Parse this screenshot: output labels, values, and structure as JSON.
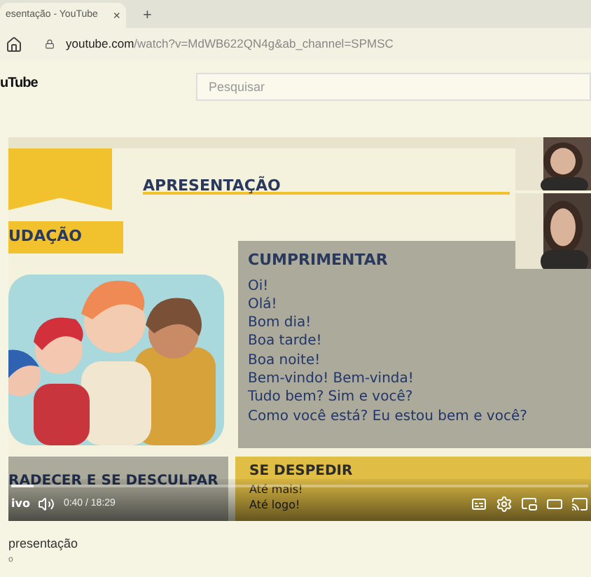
{
  "browser": {
    "tab": {
      "title": "esentação - YouTube",
      "close": "×"
    },
    "new_tab": "+",
    "url": {
      "host": "youtube.com",
      "path": "/watch?v=MdWB622QN4g&ab_channel=SPMSC"
    }
  },
  "youtube": {
    "logo": "uTube",
    "search": {
      "placeholder": "Pesquisar"
    }
  },
  "slide": {
    "heading": "APRESENTAÇÃO",
    "section": "UDAÇÃO",
    "greet": {
      "title": "CUMPRIMENTAR",
      "lines": [
        "Oi!",
        "Olá!",
        "Bom dia!",
        "Boa tarde!",
        "Boa noite!",
        "Bem-vindo! Bem-vinda!",
        "Tudo bem? Sim e você?",
        "Como você está? Eu estou bem e você?"
      ]
    },
    "thanks": {
      "title": "RADECER E SE DESCULPAR"
    },
    "farewell": {
      "title": "SE DESPEDIR",
      "lines": [
        "Até mais!",
        "Até logo!"
      ]
    }
  },
  "player": {
    "live": "ivo",
    "time": "0:40 / 18:29",
    "level": 0.04
  },
  "video": {
    "title": "presentação",
    "channel": "o"
  }
}
